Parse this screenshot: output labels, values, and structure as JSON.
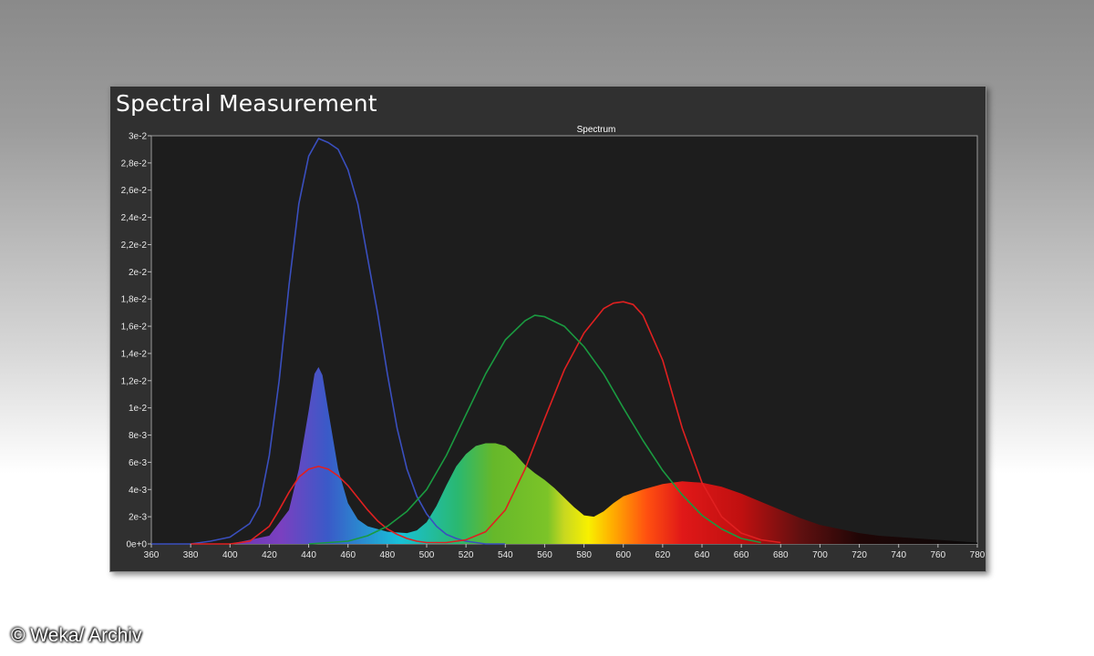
{
  "panel": {
    "title": "Spectral Measurement"
  },
  "credit": "© Weka/ Archiv",
  "chart_data": {
    "type": "area",
    "title": "Spectrum",
    "xlabel": "",
    "ylabel": "",
    "xlim": [
      360,
      780
    ],
    "ylim": [
      0,
      0.03
    ],
    "grid": false,
    "x_ticks": [
      "360",
      "380",
      "400",
      "420",
      "440",
      "460",
      "480",
      "500",
      "520",
      "540",
      "560",
      "580",
      "600",
      "620",
      "640",
      "660",
      "680",
      "700",
      "720",
      "740",
      "760",
      "780"
    ],
    "y_ticks": [
      "0e+0",
      "2e-3",
      "4e-3",
      "6e-3",
      "8e-3",
      "1e-2",
      "1,2e-2",
      "1,4e-2",
      "1,6e-2",
      "1,8e-2",
      "2e-2",
      "2,2e-2",
      "2,4e-2",
      "2,6e-2",
      "2,8e-2",
      "3e-2"
    ],
    "series": [
      {
        "kind": "area",
        "fill": "spectral-gradient",
        "x": [
          360,
          400,
          420,
          430,
          435,
          440,
          443,
          445,
          447,
          450,
          455,
          460,
          465,
          470,
          480,
          490,
          495,
          500,
          505,
          510,
          515,
          520,
          525,
          530,
          535,
          540,
          545,
          550,
          555,
          560,
          565,
          570,
          575,
          580,
          585,
          590,
          595,
          600,
          610,
          620,
          630,
          640,
          650,
          660,
          670,
          680,
          690,
          700,
          710,
          720,
          730,
          740,
          750,
          760,
          770,
          780
        ],
        "y": [
          0,
          0,
          0.0006,
          0.0025,
          0.0055,
          0.0098,
          0.0125,
          0.013,
          0.0124,
          0.0098,
          0.0055,
          0.003,
          0.0018,
          0.0013,
          0.0009,
          0.0008,
          0.001,
          0.0016,
          0.0028,
          0.0043,
          0.0057,
          0.0066,
          0.0072,
          0.0074,
          0.0074,
          0.0072,
          0.0066,
          0.0058,
          0.0052,
          0.0047,
          0.0041,
          0.0034,
          0.0027,
          0.0021,
          0.002,
          0.0024,
          0.003,
          0.0035,
          0.004,
          0.0044,
          0.0046,
          0.0045,
          0.0042,
          0.0037,
          0.0031,
          0.0025,
          0.0019,
          0.0014,
          0.0011,
          0.0008,
          0.0006,
          0.0005,
          0.0004,
          0.0003,
          0.0002,
          0.0001
        ]
      },
      {
        "kind": "line",
        "color": "#3a4fbf",
        "x": [
          360,
          380,
          390,
          400,
          410,
          415,
          420,
          425,
          430,
          435,
          440,
          445,
          450,
          455,
          460,
          465,
          470,
          475,
          480,
          485,
          490,
          495,
          500,
          505,
          510,
          515,
          520,
          530,
          540
        ],
        "y": [
          0,
          0,
          0.0002,
          0.0005,
          0.0015,
          0.0028,
          0.0065,
          0.012,
          0.019,
          0.025,
          0.0285,
          0.0298,
          0.0295,
          0.029,
          0.0275,
          0.025,
          0.021,
          0.017,
          0.0125,
          0.0085,
          0.0055,
          0.0035,
          0.0022,
          0.0013,
          0.0007,
          0.0004,
          0.0002,
          0,
          0
        ]
      },
      {
        "kind": "line",
        "color": "#e02020",
        "x": [
          380,
          400,
          410,
          420,
          425,
          430,
          435,
          440,
          445,
          450,
          455,
          460,
          465,
          470,
          475,
          480,
          485,
          490,
          495,
          500,
          510,
          520,
          530,
          540,
          550,
          560,
          570,
          580,
          590,
          595,
          600,
          605,
          610,
          620,
          630,
          640,
          650,
          660,
          670,
          680
        ],
        "y": [
          0,
          0,
          0.0002,
          0.0013,
          0.0025,
          0.0038,
          0.0049,
          0.0055,
          0.0057,
          0.0055,
          0.005,
          0.0043,
          0.0034,
          0.0025,
          0.0017,
          0.0011,
          0.0007,
          0.0004,
          0.0002,
          0.0001,
          0.0001,
          0.0003,
          0.0009,
          0.0025,
          0.0055,
          0.0092,
          0.0128,
          0.0155,
          0.0173,
          0.0177,
          0.0178,
          0.0176,
          0.0168,
          0.0135,
          0.0085,
          0.0045,
          0.002,
          0.0008,
          0.0003,
          0.0001
        ]
      },
      {
        "kind": "line",
        "color": "#1a9a40",
        "x": [
          440,
          460,
          470,
          480,
          490,
          500,
          510,
          520,
          530,
          540,
          550,
          555,
          560,
          570,
          580,
          590,
          600,
          610,
          620,
          630,
          640,
          650,
          660,
          670
        ],
        "y": [
          0,
          0.0002,
          0.0006,
          0.0013,
          0.0024,
          0.004,
          0.0065,
          0.0095,
          0.0125,
          0.015,
          0.0164,
          0.0168,
          0.0167,
          0.016,
          0.0145,
          0.0125,
          0.01,
          0.0076,
          0.0054,
          0.0036,
          0.0021,
          0.0011,
          0.0004,
          0.0001
        ]
      }
    ]
  }
}
